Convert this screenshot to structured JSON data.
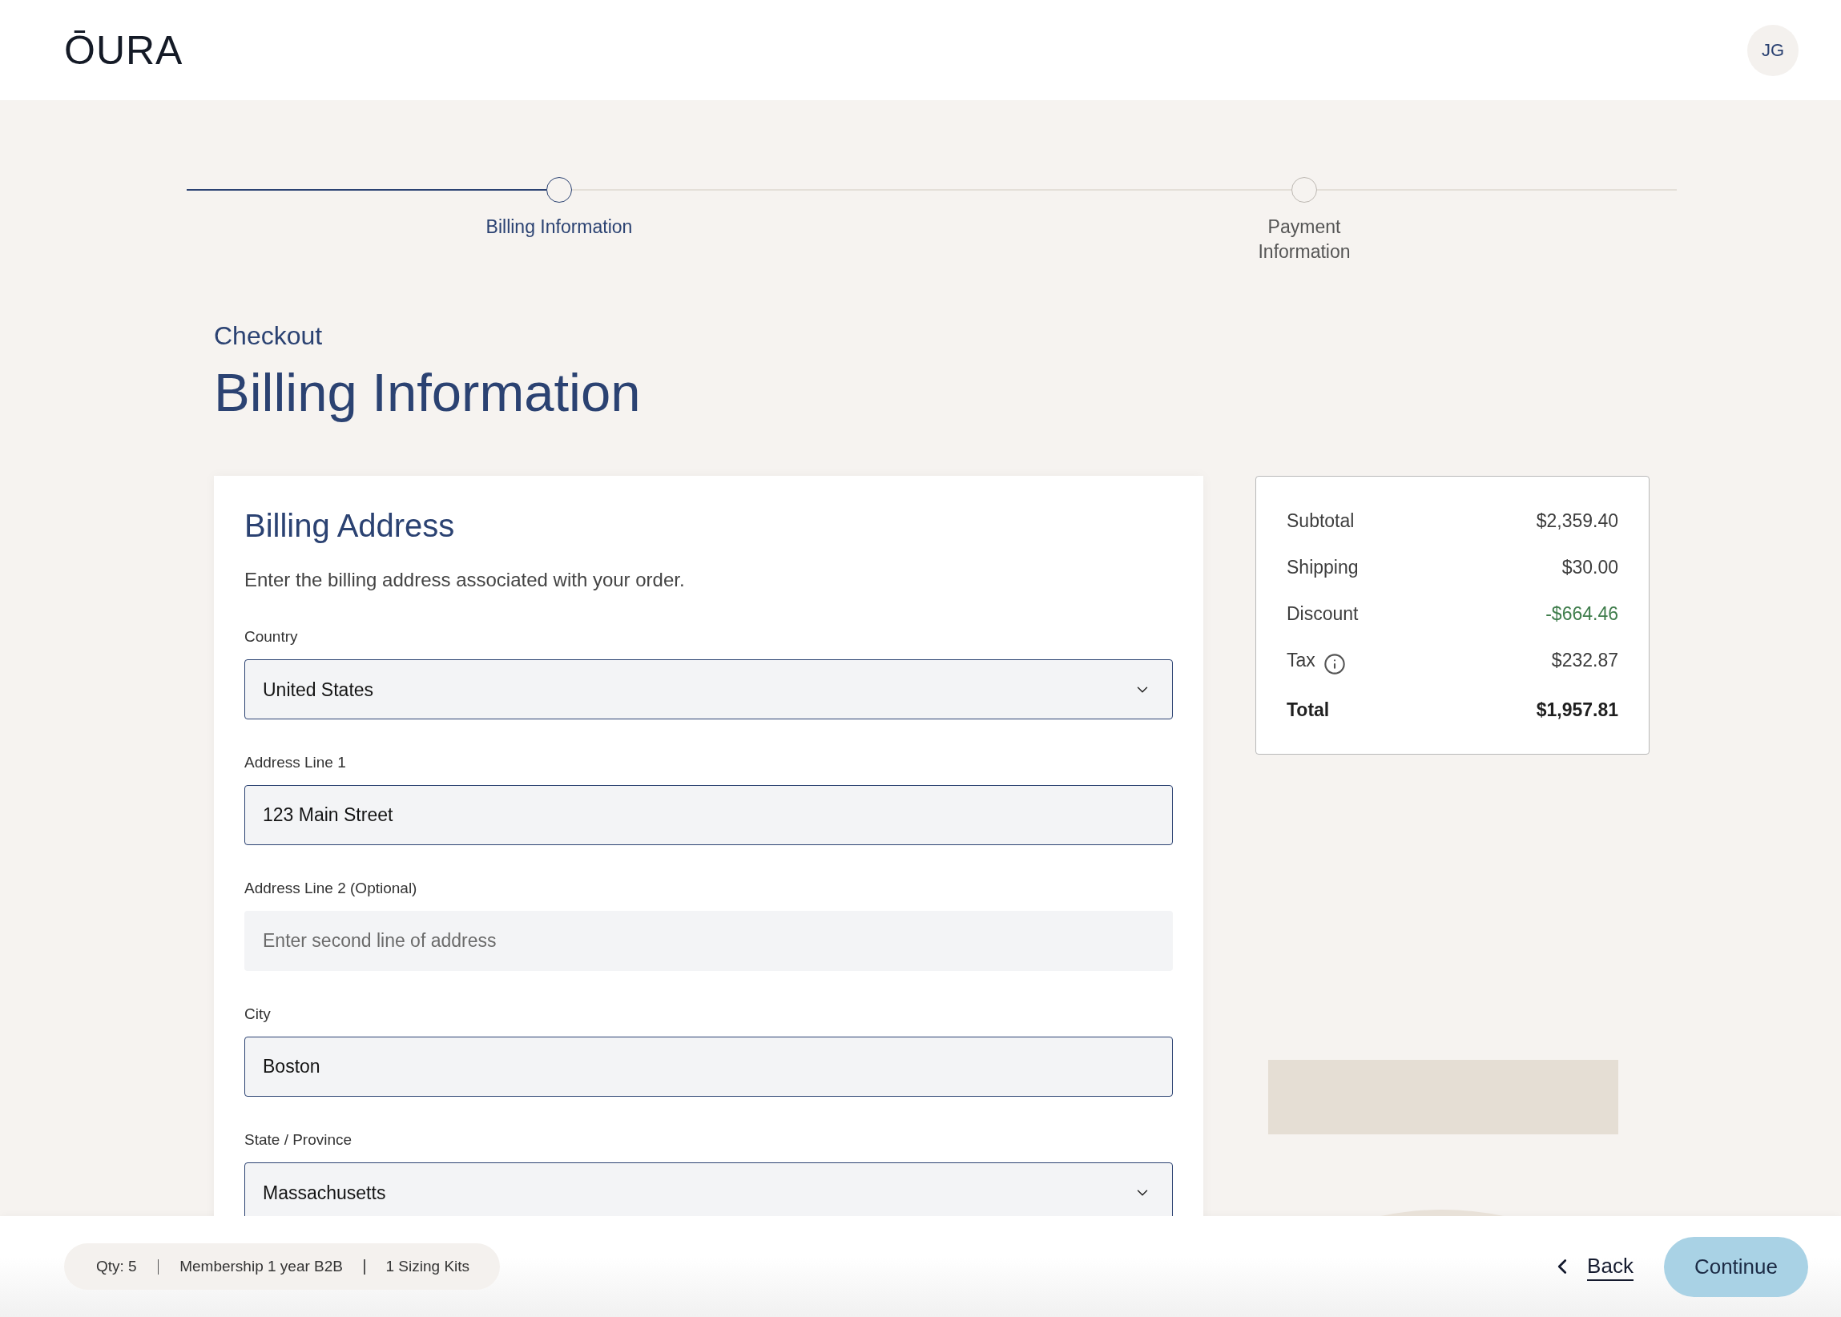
{
  "header": {
    "logo": "ŌURA",
    "avatar_initials": "JG"
  },
  "checkout_steps": [
    {
      "label": "Billing Information",
      "selected": true
    },
    {
      "label": "Payment Information",
      "selected": false
    }
  ],
  "page": {
    "breadcrumb": "Checkout",
    "title": "Billing Information"
  },
  "billing_form": {
    "title": "Billing Address",
    "description": "Enter the billing address associated with your order.",
    "fields": [
      {
        "kind": "select",
        "label": "Country",
        "value": "United States"
      },
      {
        "kind": "input",
        "label": "Address Line 1",
        "value": "123 Main Street"
      },
      {
        "kind": "input",
        "label": "Address Line 2 (Optional)",
        "placeholder": "Enter second line of address"
      },
      {
        "kind": "input",
        "label": "City",
        "value": "Boston"
      },
      {
        "kind": "select",
        "label": "State / Province",
        "value": "Massachusetts"
      }
    ]
  },
  "order_summary": {
    "rows": [
      {
        "kind": "plain",
        "label": "Subtotal",
        "value": "$2,359.40"
      },
      {
        "kind": "plain",
        "label": "Shipping",
        "value": "$30.00"
      },
      {
        "kind": "discount",
        "label": "Discount",
        "value": "-$664.46"
      },
      {
        "kind": "info",
        "label": "Tax",
        "value": "$232.87"
      },
      {
        "kind": "total",
        "label": "Total",
        "value": "$1,957.81"
      }
    ]
  },
  "footer": {
    "order_items": [
      "Qty: 5",
      "Membership 1 year B2B",
      "1 Sizing Kits"
    ],
    "back_button": "Back",
    "continue_button": "Continue"
  }
}
